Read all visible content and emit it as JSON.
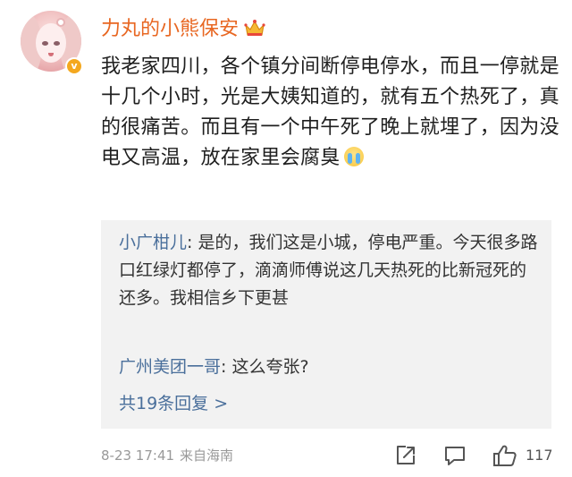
{
  "post": {
    "username": "力丸的小熊保安",
    "badge_glyph": "v",
    "text": "我老家四川，各个镇分间断停电停水，而且一停就是十几个小时，光是大姨知道的，就有五个热死了，真的很痛苦。而且有一个中午死了晚上就埋了，因为没电又高温，放在家里会腐臭",
    "emoji": "crying-face",
    "timestamp": "8-23 17:41",
    "source": "来自海南",
    "like_count": "117"
  },
  "replies": [
    {
      "author": "小广柑儿",
      "separator": ": ",
      "text": "是的，我们这是小城，停电严重。今天很多路口红绿灯都停了，滴滴师傅说这几天热死的比新冠死的还多。我相信乡下更甚"
    },
    {
      "author": "广州美团一哥",
      "separator": ": ",
      "text": "这么夸张?"
    }
  ],
  "more_replies": "共19条回复 >",
  "colors": {
    "username": "#e86722",
    "reply_author": "#4a6f9b",
    "reply_bg": "#f2f2f2",
    "meta": "#999999",
    "badge": "#f4a81f"
  },
  "icons": {
    "share": "share-icon",
    "comment": "comment-icon",
    "like": "thumbs-up-icon",
    "crown": "crown-icon"
  }
}
